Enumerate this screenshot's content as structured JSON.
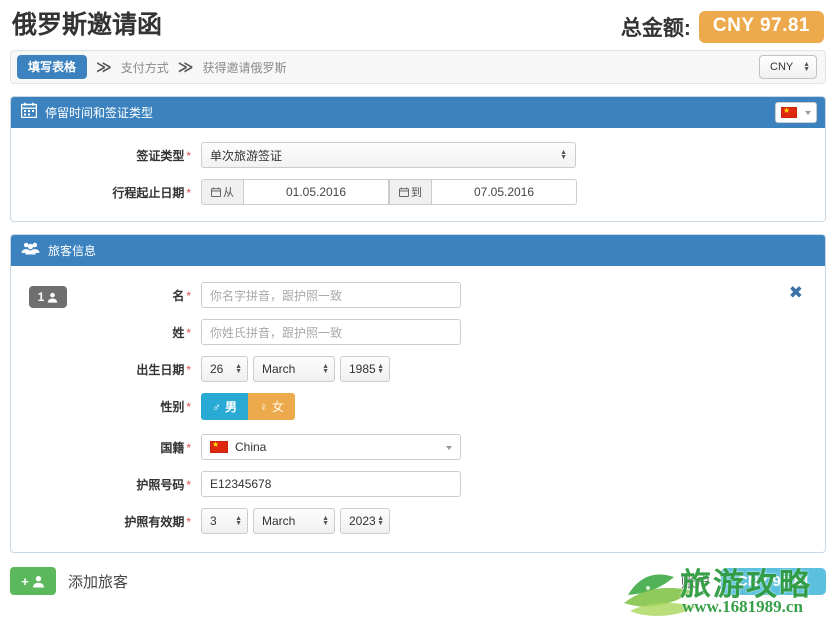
{
  "header": {
    "title": "俄罗斯邀请函",
    "total_label": "总金额:",
    "total_amount": "CNY 97.81"
  },
  "steps": {
    "items": [
      {
        "label": "填写表格",
        "active": true
      },
      {
        "label": "支付方式",
        "active": false
      },
      {
        "label": "获得邀请俄罗斯",
        "active": false
      }
    ],
    "separator": "≫",
    "currency_selected": "CNY"
  },
  "visa_panel": {
    "title": "停留时间和签证类型",
    "icon": "calendar-icon",
    "flag_selected": "China",
    "visa_type": {
      "label": "签证类型",
      "required": "*",
      "value": "单次旅游签证"
    },
    "trip_dates": {
      "label": "行程起止日期",
      "required": "*",
      "from_addon": "从",
      "from_value": "01.05.2016",
      "to_addon": "到",
      "to_value": "07.05.2016"
    }
  },
  "passenger_panel": {
    "title": "旅客信息",
    "icon": "people-icon",
    "passenger": {
      "badge_number": "1",
      "close_icon": "close-icon",
      "first_name": {
        "label": "名",
        "required": "*",
        "value": "",
        "placeholder": "你名字拼音，跟护照一致"
      },
      "last_name": {
        "label": "姓",
        "required": "*",
        "value": "",
        "placeholder": "你姓氏拼音，跟护照一致"
      },
      "birth_date": {
        "label": "出生日期",
        "required": "*",
        "day": "26",
        "month": "March",
        "year": "1985"
      },
      "gender": {
        "label": "性别",
        "required": "*",
        "male_label": "男",
        "male_icon": "♂",
        "female_label": "女",
        "female_icon": "♀",
        "selected": "male"
      },
      "nationality": {
        "label": "国籍",
        "required": "*",
        "value": "China",
        "flag": "cn-flag-icon"
      },
      "passport_number": {
        "label": "护照号码",
        "required": "*",
        "value": "E12345678"
      },
      "passport_expiry": {
        "label": "护照有效期",
        "required": "*",
        "day": "3",
        "month": "March",
        "year": "2023"
      }
    }
  },
  "footer": {
    "add_passenger_label": "添加旅客",
    "add_passenger_icon": "add-user-icon",
    "account_label": "账户",
    "pay_badge": "CNY 97.81"
  },
  "watermark": {
    "text": "旅游攻略",
    "url": "www.1681989.cn"
  },
  "colors": {
    "brand_blue": "#3b82bf",
    "accent_orange": "#edaa4d",
    "male_blue": "#29aad4",
    "green": "#5cb85c",
    "required_red": "#d9534f"
  }
}
